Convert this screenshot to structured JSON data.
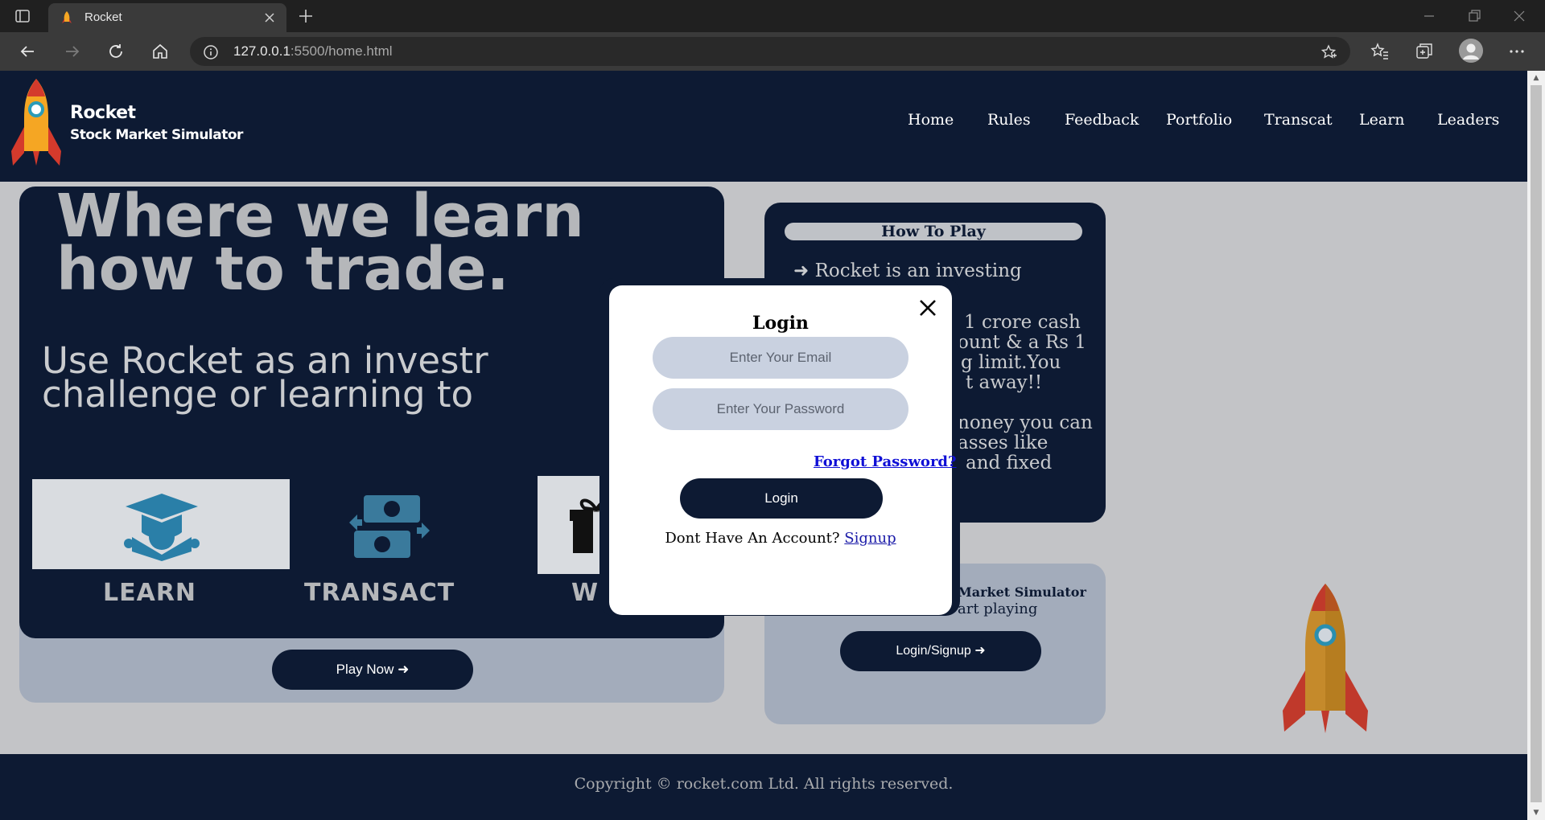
{
  "browser": {
    "tab_title": "Rocket",
    "url_host": "127.0.0.1",
    "url_path": ":5500/home.html",
    "window_controls": [
      "minimize-icon",
      "restore-icon",
      "close-icon"
    ],
    "toolbar_icons": [
      "favorites-add-icon",
      "favorites-icon",
      "collections-icon",
      "profile-icon",
      "more-icon"
    ]
  },
  "site": {
    "brand_title": "Rocket",
    "brand_subtitle": "Stock Market Simulator",
    "nav": [
      "Home",
      "Rules",
      "Feedback",
      "Portfolio",
      "Transcat",
      "Learn",
      "Leaders"
    ]
  },
  "hero": {
    "headline_line1": "Where we learn",
    "headline_line2": "how to trade.",
    "sub_line1": "Use Rocket as an investr",
    "sub_line2": "challenge or learning to",
    "features": [
      "LEARN",
      "TRANSACT",
      "W"
    ],
    "play_button": "Play Now ➜"
  },
  "howto": {
    "title": "How To Play",
    "lines": [
      "➜ Rocket is an investing",
      "1 crore cash",
      "ount & a Rs 1",
      "g limit.You",
      "t away!!",
      "noney you can",
      "asses like",
      "and fixed"
    ]
  },
  "signup_card": {
    "line1": "Market Simulator",
    "line2": "art playing",
    "button": "Login/Signup ➜"
  },
  "footer": {
    "copyright": "Copyright © rocket.com Ltd. All rights reserved."
  },
  "modal": {
    "title": "Login",
    "email_placeholder": "Enter Your Email",
    "password_placeholder": "Enter Your Password",
    "forgot_link": "Forgot Password?",
    "login_button": "Login",
    "account_prompt": "Dont Have An Account?",
    "signup_link": "Signup"
  },
  "colors": {
    "navy": "#0d1a33",
    "page_bg": "#c3c4c7",
    "field_bg": "#c9d1e0",
    "link_blue": "#1010d6",
    "rocket_red": "#d43a2c",
    "rocket_orange": "#f5a623"
  }
}
